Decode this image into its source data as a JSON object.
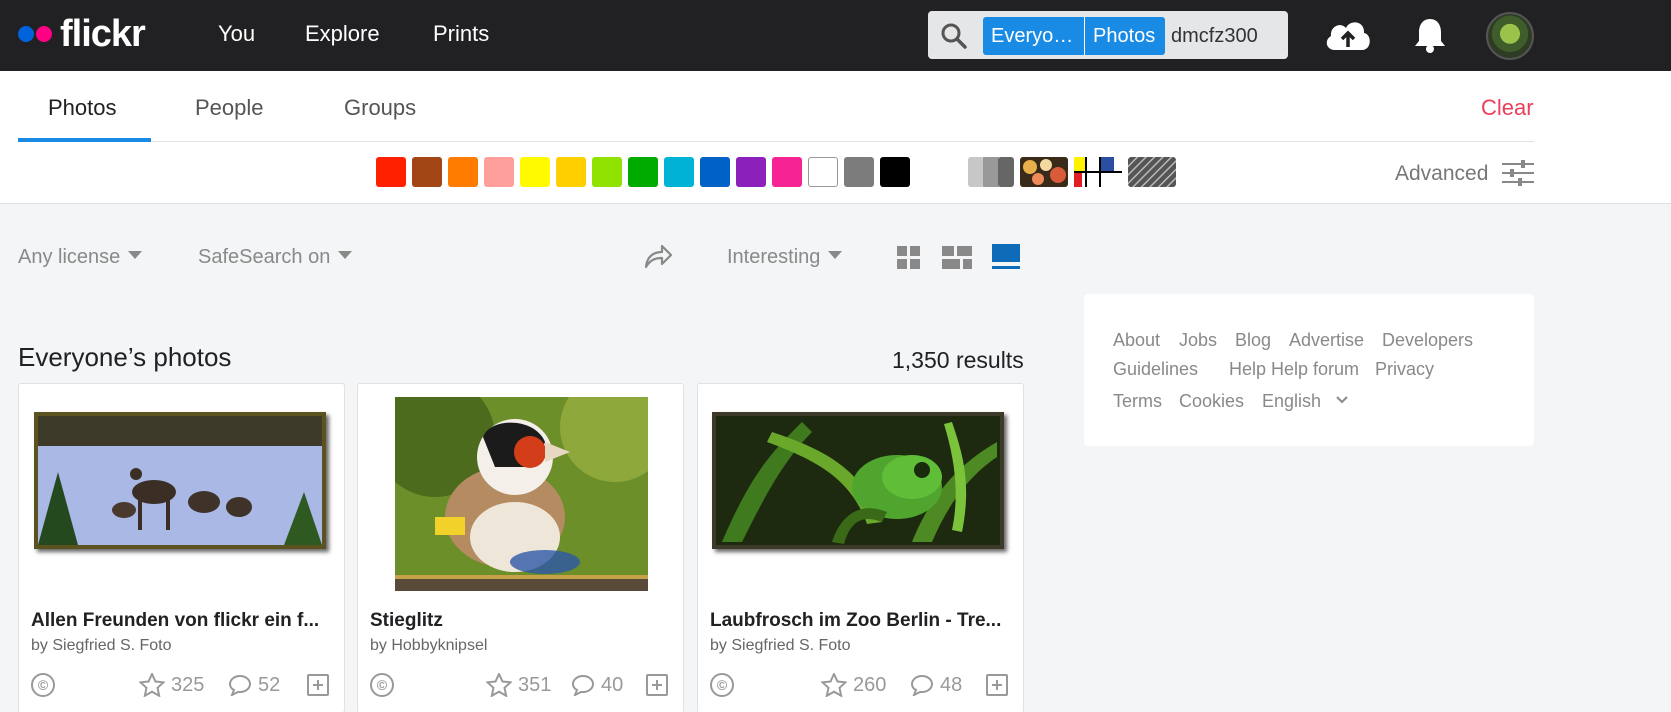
{
  "topbar": {
    "logo_text": "flickr",
    "nav": [
      "You",
      "Explore",
      "Prints"
    ],
    "search": {
      "scope": "Everyo…",
      "type": "Photos",
      "query": "dmcfz300"
    }
  },
  "tabs": [
    "Photos",
    "People",
    "Groups"
  ],
  "clear_label": "Clear",
  "colors": [
    "#ff2000",
    "#a24615",
    "#ff7c00",
    "#ff9f9c",
    "#fffa00",
    "#ffcf00",
    "#90e200",
    "#00ab00",
    "#00b2d4",
    "#0062c6",
    "#8c20ba",
    "#f52394",
    "#ffffff",
    "#7c7c7c",
    "#000000"
  ],
  "advanced_label": "Advanced",
  "filters": {
    "license": "Any license",
    "safesearch": "SafeSearch on",
    "sort": "Interesting"
  },
  "heading": "Everyone’s photos",
  "results": "1,350 results",
  "photos": [
    {
      "title": "Allen Freunden von flickr ein f...",
      "author": "by Siegfried S. Foto",
      "license": "©",
      "faves": "325",
      "comments": "52"
    },
    {
      "title": "Stieglitz",
      "author": "by Hobbyknipsel",
      "license": "©",
      "faves": "351",
      "comments": "40"
    },
    {
      "title": "Laubfrosch im Zoo Berlin - Tre...",
      "author": "by Siegfried S. Foto",
      "license": "©",
      "faves": "260",
      "comments": "48"
    }
  ],
  "footer_links": [
    "About",
    "Jobs",
    "Blog",
    "Advertise",
    "Developers",
    "Guidelines",
    "Help",
    "Help forum",
    "Privacy",
    "Terms",
    "Cookies",
    "English"
  ]
}
